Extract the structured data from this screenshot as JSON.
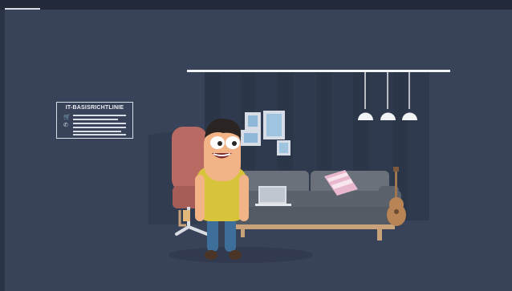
{
  "video": {
    "progress_fraction": 0.07
  },
  "policy_card": {
    "title": "IT-BASISRICHTLINIE",
    "icons": [
      "cart-icon",
      "phone-icon"
    ]
  },
  "colors": {
    "background": "#384359",
    "character_shirt": "#d8c43a",
    "sofa": "#5f6670",
    "armchair": "#b86a63"
  }
}
